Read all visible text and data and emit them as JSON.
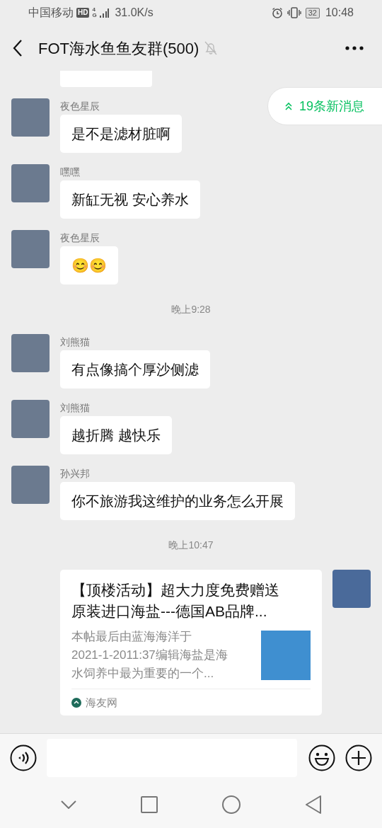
{
  "status_bar": {
    "carrier": "中国移动",
    "hd_badge": "HD",
    "network": "4G",
    "speed": "31.0K/s",
    "battery": "32",
    "time": "10:48"
  },
  "header": {
    "title": "FOT海水鱼鱼友群(500)",
    "muted": true
  },
  "new_messages_pill": "19条新消息",
  "messages": [
    {
      "kind": "partial"
    },
    {
      "kind": "text",
      "sender": "夜色星辰",
      "text": "是不是滤材脏啊"
    },
    {
      "kind": "text",
      "sender": "嘿嘿",
      "text": "新缸无视 安心养水"
    },
    {
      "kind": "text",
      "sender": "夜色星辰",
      "text": "😊😊"
    },
    {
      "kind": "time",
      "text": "晚上9:28"
    },
    {
      "kind": "text",
      "sender": "刘熊猫",
      "text": "有点像搞个厚沙侧滤"
    },
    {
      "kind": "text",
      "sender": "刘熊猫",
      "text": "越折腾  越快乐"
    },
    {
      "kind": "text",
      "sender": "孙兴邦",
      "text": "你不旅游我这维护的业务怎么开展"
    },
    {
      "kind": "time",
      "text": "晚上10:47"
    },
    {
      "kind": "link",
      "title_lines": [
        "【顶楼活动】超大力度免费赠送",
        "原装进口海盐---德国AB品牌..."
      ],
      "description_lines": [
        "本帖最后由蓝海海洋于",
        "2021-1-2011:37编辑海盐是海",
        "水饲养中最为重要的一个..."
      ],
      "source": "海友网"
    }
  ]
}
